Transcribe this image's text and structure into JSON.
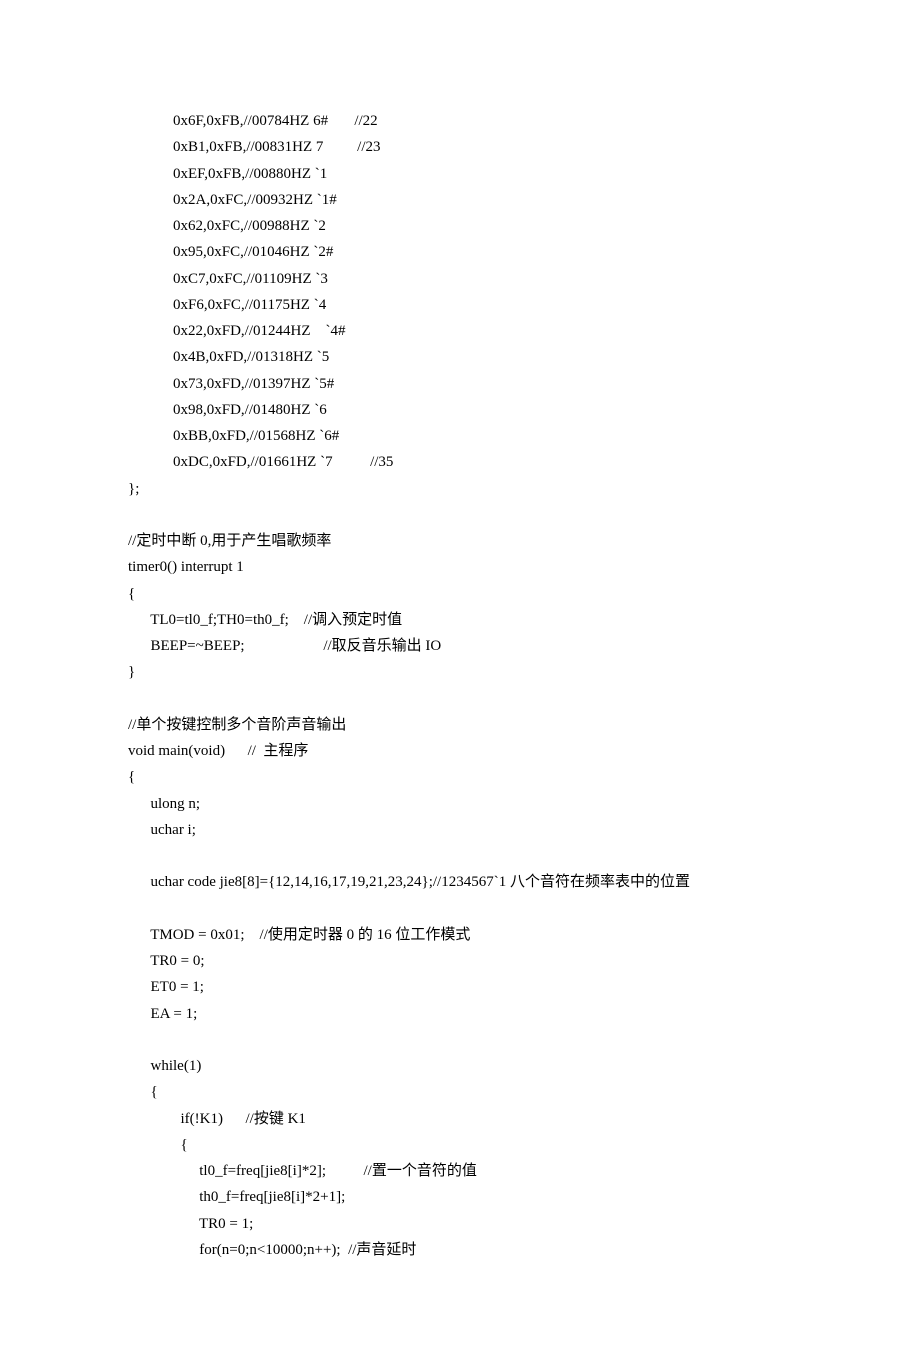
{
  "code": {
    "lines": [
      "            0x6F,0xFB,//00784HZ 6#       //22",
      "            0xB1,0xFB,//00831HZ 7         //23",
      "            0xEF,0xFB,//00880HZ `1",
      "            0x2A,0xFC,//00932HZ `1#",
      "            0x62,0xFC,//00988HZ `2",
      "            0x95,0xFC,//01046HZ `2#",
      "            0xC7,0xFC,//01109HZ `3",
      "            0xF6,0xFC,//01175HZ `4",
      "            0x22,0xFD,//01244HZ    `4#",
      "            0x4B,0xFD,//01318HZ `5",
      "            0x73,0xFD,//01397HZ `5#",
      "            0x98,0xFD,//01480HZ `6",
      "            0xBB,0xFD,//01568HZ `6#",
      "            0xDC,0xFD,//01661HZ `7          //35",
      "};",
      "",
      "//定时中断 0,用于产生唱歌频率",
      "timer0() interrupt 1",
      "{",
      "      TL0=tl0_f;TH0=th0_f;    //调入预定时值",
      "      BEEP=~BEEP;                     //取反音乐输出 IO",
      "}",
      "",
      "//单个按键控制多个音阶声音输出",
      "void main(void)      //  主程序",
      "{",
      "      ulong n;",
      "      uchar i;",
      "",
      "      uchar code jie8[8]={12,14,16,17,19,21,23,24};//1234567`1 八个音符在频率表中的位置",
      "",
      "      TMOD = 0x01;    //使用定时器 0 的 16 位工作模式",
      "      TR0 = 0;",
      "      ET0 = 1;",
      "      EA = 1;",
      "",
      "      while(1)",
      "      {",
      "              if(!K1)      //按键 K1",
      "              {",
      "                   tl0_f=freq[jie8[i]*2];          //置一个音符的值",
      "                   th0_f=freq[jie8[i]*2+1];",
      "                   TR0 = 1;",
      "                   for(n=0;n<10000;n++);  //声音延时"
    ]
  }
}
